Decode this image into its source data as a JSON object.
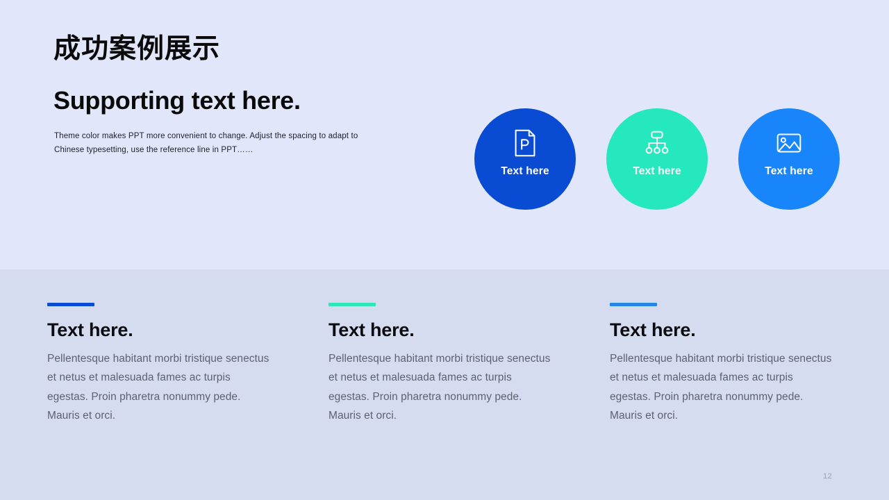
{
  "slide": {
    "page_number": "12",
    "background_top": "#e1e6fa",
    "background_bottom": "#d6dcf0"
  },
  "header": {
    "title_cn": "成功案例展示",
    "title_en": "Supporting text here.",
    "subtext": "Theme color makes PPT more convenient to change. Adjust the spacing to adapt to Chinese typesetting, use the reference line in PPT……"
  },
  "circles": [
    {
      "label": "Text here",
      "color": "#0a4bd4",
      "icon": "file-p-icon"
    },
    {
      "label": "Text here",
      "color": "#25e8be",
      "icon": "org-chart-icon"
    },
    {
      "label": "Text here",
      "color": "#1886fa",
      "icon": "image-icon"
    }
  ],
  "columns": [
    {
      "title": "Text here.",
      "body": "Pellentesque habitant morbi tristique senectus et netus et malesuada fames ac turpis egestas. Proin pharetra nonummy pede. Mauris et orci.",
      "accent": "#0a4bd4"
    },
    {
      "title": "Text here.",
      "body": "Pellentesque habitant morbi tristique senectus et netus et malesuada fames ac turpis egestas. Proin pharetra nonummy pede. Mauris et orci.",
      "accent": "#2ee6b8"
    },
    {
      "title": "Text here.",
      "body": "Pellentesque habitant morbi tristique senectus et netus et malesuada fames ac turpis egestas. Proin pharetra nonummy pede. Mauris et orci.",
      "accent": "#2584e8"
    }
  ]
}
